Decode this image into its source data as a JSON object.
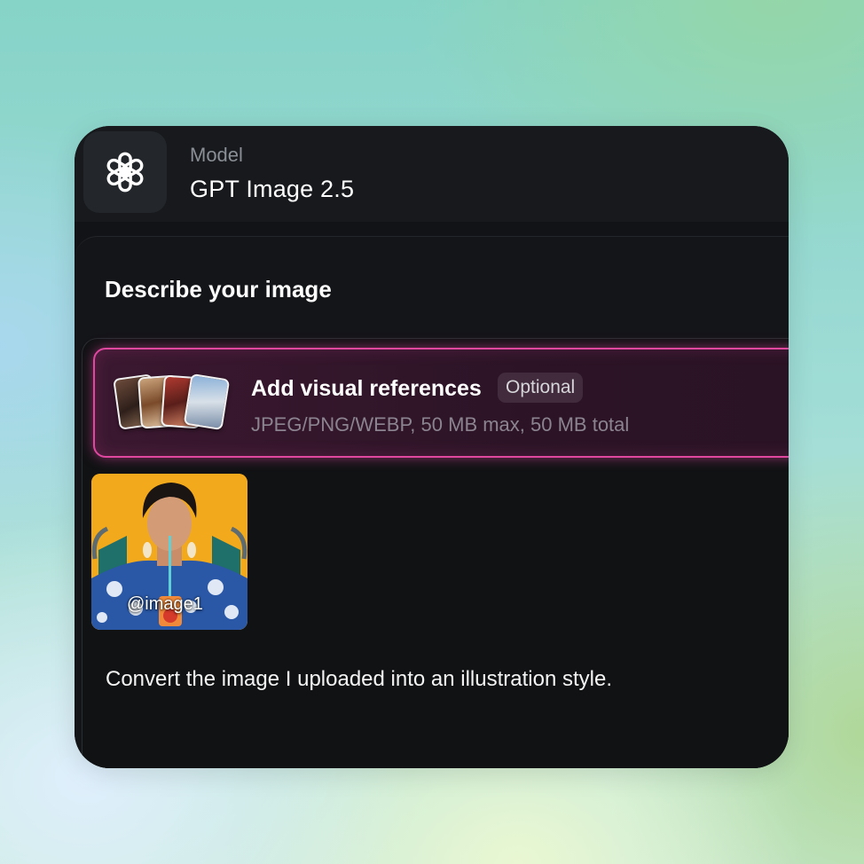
{
  "header": {
    "model_label": "Model",
    "model_name": "GPT Image 2.5",
    "logo_icon": "openai-logo-icon"
  },
  "prompt_section": {
    "title": "Describe your image",
    "references": {
      "title": "Add visual references",
      "badge": "Optional",
      "subtitle": "JPEG/PNG/WEBP, 50 MB max, 50 MB total"
    },
    "uploaded_image": {
      "tag": "@image1"
    },
    "prompt_text": "Convert the image I uploaded into an illustration style."
  },
  "colors": {
    "accent": "#e0489f",
    "card_background": "#121316"
  }
}
